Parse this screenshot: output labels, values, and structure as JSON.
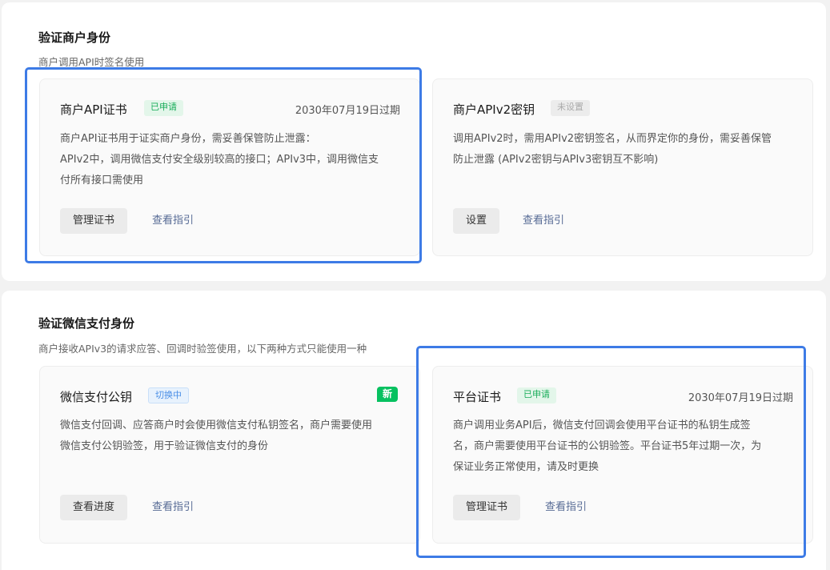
{
  "section1": {
    "title": "验证商户身份",
    "subtitle": "商户调用API时签名使用",
    "cards": [
      {
        "title": "商户API证书",
        "status": "已申请",
        "expiry": "2030年07月19日过期",
        "desc": [
          "商户API证书用于证实商户身份，需妥善保管防止泄露：",
          "APIv2中，调用微信支付安全级别较高的接口；APIv3中，调用微信支",
          "付所有接口需使用"
        ],
        "button": "管理证书",
        "link": "查看指引"
      },
      {
        "title": "商户APIv2密钥",
        "status": "未设置",
        "desc": [
          "调用APIv2时，需用APIv2密钥签名，从而界定你的身份，需妥善保管",
          "防止泄露 (APIv2密钥与APIv3密钥互不影响)"
        ],
        "button": "设置",
        "link": "查看指引"
      }
    ]
  },
  "section2": {
    "title": "验证微信支付身份",
    "subtitle": "商户接收APIv3的请求应答、回调时验签使用，以下两种方式只能使用一种",
    "cards": [
      {
        "title": "微信支付公钥",
        "status": "切换中",
        "badge": "新",
        "desc": [
          "微信支付回调、应答商户时会使用微信支付私钥签名，商户需要使用",
          "微信支付公钥验签，用于验证微信支付的身份"
        ],
        "button": "查看进度",
        "link": "查看指引"
      },
      {
        "title": "平台证书",
        "status": "已申请",
        "expiry": "2030年07月19日过期",
        "desc": [
          "商户调用业务API后，微信支付回调会使用平台证书的私钥生成签",
          "名，商户需要使用平台证书的公钥验签。平台证书5年过期一次，为",
          "保证业务正常使用，请及时更换"
        ],
        "button": "管理证书",
        "link": "查看指引"
      }
    ]
  },
  "colors": {
    "accent_link": "#576b95",
    "status_green": "#1aad5b",
    "badge_new": "#07c160",
    "highlight": "#3d7be6"
  }
}
